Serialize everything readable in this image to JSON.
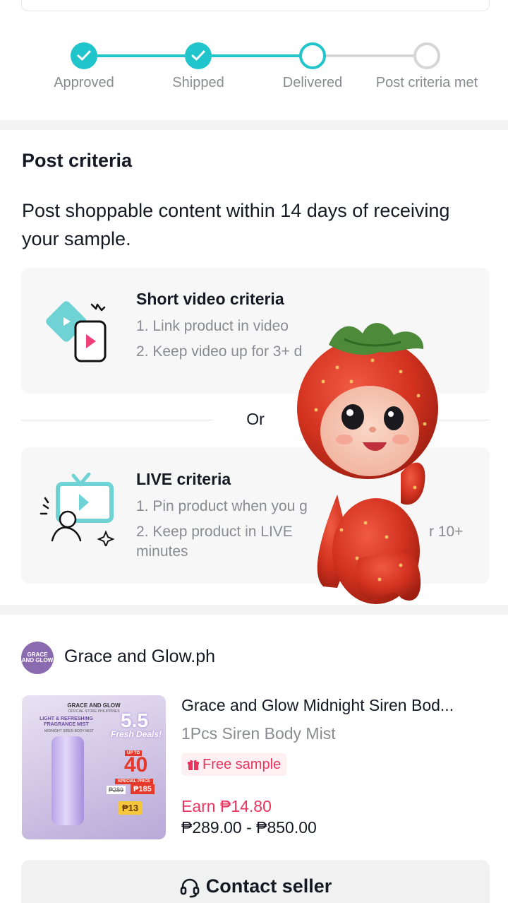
{
  "progress": {
    "steps": [
      {
        "label": "Approved",
        "state": "done"
      },
      {
        "label": "Shipped",
        "state": "done"
      },
      {
        "label": "Delivered",
        "state": "current"
      },
      {
        "label": "Post criteria met",
        "state": "todo"
      }
    ]
  },
  "criteria": {
    "title": "Post criteria",
    "description": "Post shoppable content within 14 days of receiving your sample.",
    "short_video": {
      "title": "Short video criteria",
      "line1": "1. Link product in video",
      "line2": "2. Keep video up for 3+ d"
    },
    "or_label": "Or",
    "live": {
      "title": "LIVE criteria",
      "line1": "1. Pin product when you g",
      "line2a": "2. Keep product in LIVE",
      "line2b": "r 10+",
      "line3": "minutes"
    }
  },
  "seller": {
    "avatar_text": "GRACE AND GLOW",
    "name": "Grace and Glow.ph"
  },
  "product": {
    "image_brand": "GRACE AND GLOW",
    "image_sub": "OFFICIAL STORE PHILIPPINES",
    "image_product": "LIGHT & REFRESHING FRAGRANCE MIST",
    "image_variant": "MIDNIGHT SIREN BODY MIST",
    "image_promo": "5.5",
    "image_promo_sub": "Fresh Deals!",
    "image_upto": "UP TO",
    "image_discount": "40",
    "image_special": "SPECIAL PRICE",
    "image_old_price": "₱289",
    "image_new_price": "₱185",
    "image_voucher": "₱13",
    "title": "Grace and Glow Midnight Siren Bod...",
    "variant": "1Pcs Siren Body Mist",
    "badge": "Free sample",
    "earn": "Earn ₱14.80",
    "price_range": "₱289.00 - ₱850.00"
  },
  "contact": {
    "label": "Contact seller"
  },
  "colors": {
    "accent_teal": "#20c4cb",
    "brand_pink": "#e8345e",
    "muted_text": "#8a8b91"
  }
}
